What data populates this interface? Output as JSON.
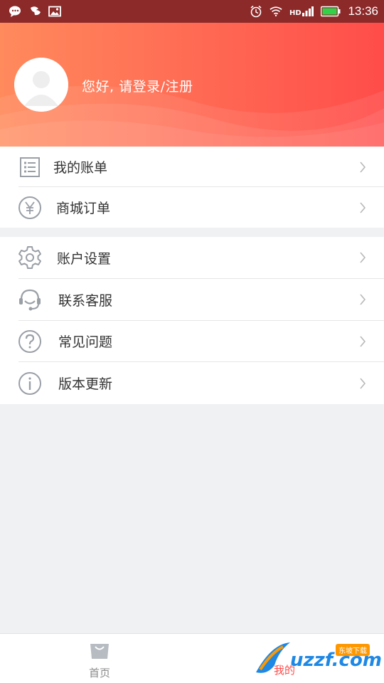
{
  "status_bar": {
    "time": "13:36",
    "left_icons": [
      "chat-icon",
      "wechat-icon",
      "image-icon"
    ],
    "right_icons": [
      "alarm-icon",
      "wifi-icon",
      "hd-signal-icon",
      "battery-icon"
    ]
  },
  "header": {
    "login_prompt": "您好, 请登录/注册",
    "colors": {
      "gradient_start": "#ff8a5c",
      "gradient_end": "#ff4d4a"
    }
  },
  "menu": {
    "group1": [
      {
        "label": "我的账单",
        "icon": "bill-list-icon"
      },
      {
        "label": "商城订单",
        "icon": "yen-circle-icon"
      }
    ],
    "group2": [
      {
        "label": "账户设置",
        "icon": "gear-icon"
      },
      {
        "label": "联系客服",
        "icon": "headset-icon"
      },
      {
        "label": "常见问题",
        "icon": "question-circle-icon"
      },
      {
        "label": "版本更新",
        "icon": "info-circle-icon"
      }
    ]
  },
  "bottom_nav": {
    "home_label": "首页",
    "mine_label": "我的",
    "active": "mine",
    "accent_color": "#ff4d4a"
  },
  "watermark": {
    "text": "uzzf.com",
    "badge": "东坡下载"
  }
}
